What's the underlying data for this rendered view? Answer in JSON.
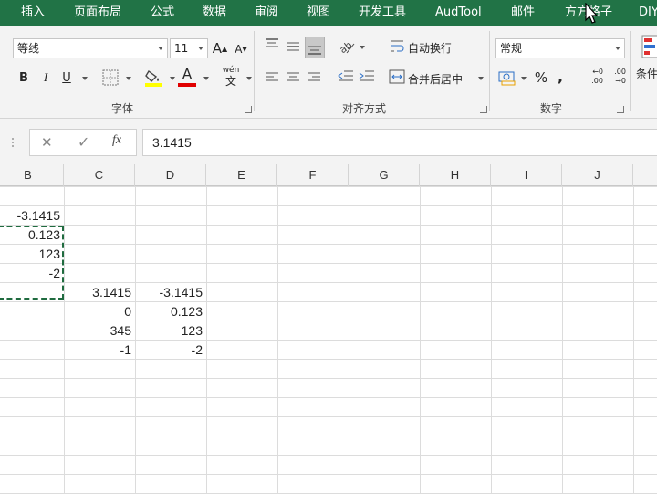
{
  "menu": {
    "tabs": [
      "插入",
      "页面布局",
      "公式",
      "数据",
      "审阅",
      "视图",
      "开发工具",
      "AudTool",
      "邮件",
      "方方格子",
      "DIY"
    ]
  },
  "ribbon": {
    "font": {
      "name": "等线",
      "size": "11",
      "grow_label": "A",
      "shrink_label": "A",
      "bold": "B",
      "italic": "I",
      "underline": "U",
      "font_color_letter": "A",
      "phonetic_top": "wén",
      "phonetic_bottom": "文",
      "group_label": "字体"
    },
    "alignment": {
      "wrap_text": "自动换行",
      "merge_center": "合并后居中",
      "group_label": "对齐方式"
    },
    "number": {
      "format": "常规",
      "percent": "%",
      "comma": ",",
      "inc_decimal": ".00",
      "dec_decimal": ".00",
      "group_label": "数字"
    },
    "styles": {
      "conditional_label": "条件"
    },
    "colors": {
      "highlight": "#ffff00",
      "font_color": "#e00000",
      "theme": "#217346"
    }
  },
  "formula_bar": {
    "cancel": "✕",
    "enter": "✓",
    "fx": "fx",
    "value": "3.1415"
  },
  "grid": {
    "columns": [
      "B",
      "C",
      "D",
      "E",
      "F",
      "G",
      "H",
      "I",
      "J"
    ],
    "cells": [
      {
        "col": "B",
        "row": 2,
        "value": "-3.1415"
      },
      {
        "col": "B",
        "row": 3,
        "value": "0.123"
      },
      {
        "col": "B",
        "row": 4,
        "value": "123"
      },
      {
        "col": "B",
        "row": 5,
        "value": "-2"
      },
      {
        "col": "C",
        "row": 6,
        "value": "3.1415"
      },
      {
        "col": "D",
        "row": 6,
        "value": "-3.1415"
      },
      {
        "col": "C",
        "row": 7,
        "value": "0"
      },
      {
        "col": "D",
        "row": 7,
        "value": "0.123"
      },
      {
        "col": "C",
        "row": 8,
        "value": "345"
      },
      {
        "col": "D",
        "row": 8,
        "value": "123"
      },
      {
        "col": "C",
        "row": 9,
        "value": "-1"
      },
      {
        "col": "D",
        "row": 9,
        "value": "-2"
      }
    ]
  }
}
